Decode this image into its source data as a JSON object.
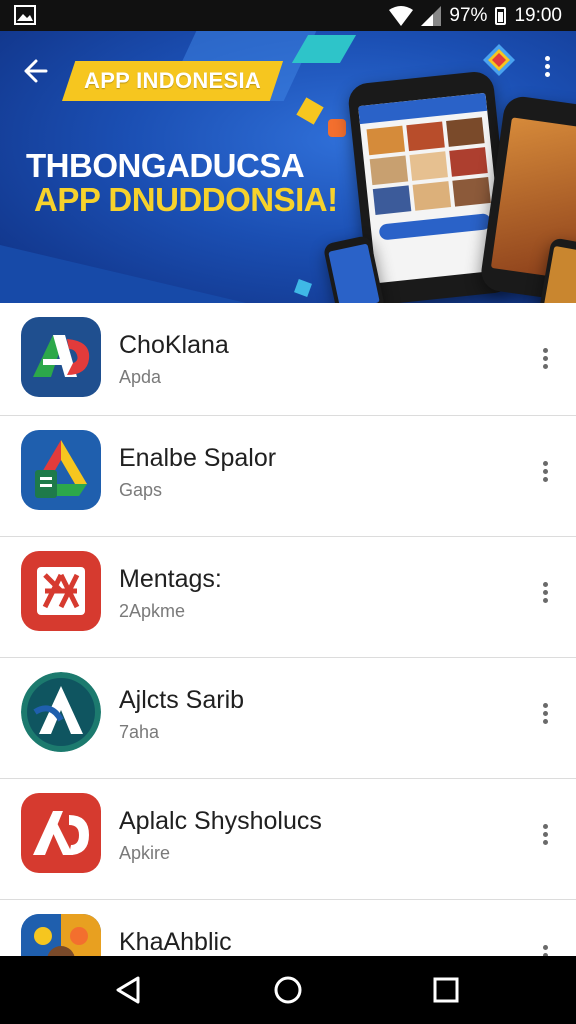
{
  "status_bar": {
    "battery_text": "97%",
    "time": "19:00",
    "icons": [
      "image-icon",
      "wifi-icon",
      "signal-icon",
      "battery-icon"
    ]
  },
  "banner": {
    "ribbon_text": "APP INDONESIA",
    "headline_line1": "THBONGADUCSA",
    "headline_line2": "APP DNUDDONSIA!",
    "accent_color": "#f6c61f",
    "background_color": "#1b4fb3"
  },
  "apps": [
    {
      "title": "ChoKlana",
      "subtitle": "Apda",
      "icon": "ad-logo-icon",
      "icon_color": "#1f4f8f"
    },
    {
      "title": "Enalbe Spalor",
      "subtitle": "Gaps",
      "icon": "drive-logo-icon",
      "icon_color": "#1f5fae"
    },
    {
      "title": "Mentags:",
      "subtitle": "2Apkme",
      "icon": "grid-logo-icon",
      "icon_color": "#d63a2f"
    },
    {
      "title": "Ajlcts Sarib",
      "subtitle": "7aha",
      "icon": "a-logo-icon",
      "icon_color": "#1c7a6e"
    },
    {
      "title": "Aplalc Shysholucs",
      "subtitle": "Apkire",
      "icon": "ag-logo-icon",
      "icon_color": "#d63a2f"
    },
    {
      "title": "KhaAhblic",
      "subtitle": "",
      "icon": "photo-logo-icon",
      "icon_color": "#e8a020"
    }
  ],
  "nav_bar": {
    "buttons": [
      "back-triangle-icon",
      "home-circle-icon",
      "recents-square-icon"
    ]
  }
}
